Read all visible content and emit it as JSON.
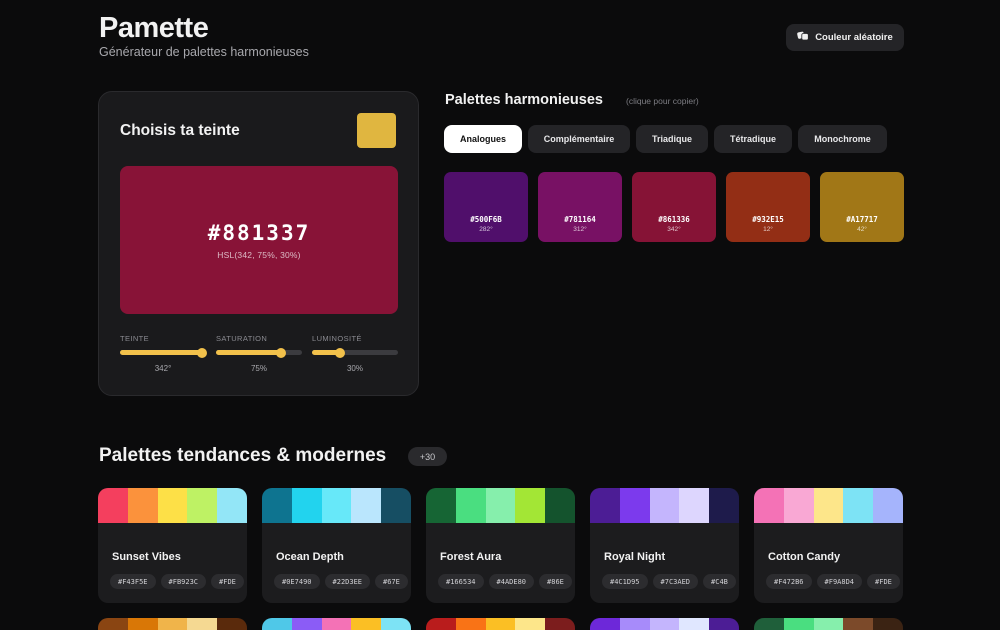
{
  "header": {
    "title": "Pamette",
    "subtitle": "Générateur de palettes harmonieuses",
    "random_button": "Couleur aléatoire",
    "random_icon": "dice-icon"
  },
  "picker": {
    "title": "Choisis ta teinte",
    "current_color": "#881337",
    "hex": "#881337",
    "hsl": "HSL(342, 75%, 30%)",
    "sliders": [
      {
        "label": "TEINTE",
        "value": "342°",
        "fraction": 0.95
      },
      {
        "label": "SATURATION",
        "value": "75%",
        "fraction": 0.75
      },
      {
        "label": "LUMINOSITÉ",
        "value": "30%",
        "fraction": 0.33
      }
    ],
    "accent": "#F2C14B",
    "swatch_color": "#E0B640"
  },
  "harmony": {
    "title": "Palettes harmonieuses",
    "hint": "(clique pour copier)",
    "tabs": [
      {
        "label": "Analogues",
        "active": true
      },
      {
        "label": "Complémentaire",
        "active": false
      },
      {
        "label": "Triadique",
        "active": false
      },
      {
        "label": "Tétradique",
        "active": false
      },
      {
        "label": "Monochrome",
        "active": false
      }
    ],
    "swatches": [
      {
        "hex": "#500F6B",
        "deg": "282°"
      },
      {
        "hex": "#781164",
        "deg": "312°"
      },
      {
        "hex": "#861336",
        "deg": "342°"
      },
      {
        "hex": "#932E15",
        "deg": "12°"
      },
      {
        "hex": "#A17717",
        "deg": "42°"
      }
    ]
  },
  "trends": {
    "title": "Palettes tendances & modernes",
    "count_badge": "+30",
    "palettes": [
      {
        "name": "Sunset Vibes",
        "colors": [
          "#F43F5E",
          "#FB923C",
          "#FDE047",
          "#BEF264",
          "#93E6F7"
        ],
        "chips": [
          "#F43F5E",
          "#FB923C",
          "#FDE"
        ]
      },
      {
        "name": "Ocean Depth",
        "colors": [
          "#0E7490",
          "#22D3EE",
          "#67E8F9",
          "#BAE6FD",
          "#164E63"
        ],
        "chips": [
          "#0E7490",
          "#22D3EE",
          "#67E"
        ]
      },
      {
        "name": "Forest Aura",
        "colors": [
          "#166534",
          "#4ADE80",
          "#86EFAC",
          "#A3E635",
          "#14532D"
        ],
        "chips": [
          "#166534",
          "#4ADE80",
          "#86E"
        ]
      },
      {
        "name": "Royal Night",
        "colors": [
          "#4C1D95",
          "#7C3AED",
          "#C4B5FD",
          "#DDD6FE",
          "#1E1B4B"
        ],
        "chips": [
          "#4C1D95",
          "#7C3AED",
          "#C4B"
        ]
      },
      {
        "name": "Cotton Candy",
        "colors": [
          "#F472B6",
          "#F9A8D4",
          "#FDE68A",
          "#7DE3F5",
          "#A5B4FC"
        ],
        "chips": [
          "#F472B6",
          "#F9A8D4",
          "#FDE"
        ]
      }
    ],
    "row2_colors": [
      [
        "#8A4512",
        "#D97706",
        "#F0B44A",
        "#F5D992",
        "#5A2A0C"
      ],
      [
        "#4FC8E8",
        "#8B5CF6",
        "#F472B6",
        "#FBBF24",
        "#7DE3F5"
      ],
      [
        "#B91C1C",
        "#F97316",
        "#FBBF24",
        "#FDE68A",
        "#7C1D1D"
      ],
      [
        "#6D28D9",
        "#A78BFA",
        "#C4B5FD",
        "#E0E7FF",
        "#4C1D95"
      ],
      [
        "#1F5F3A",
        "#4ADE80",
        "#86EFAC",
        "#7C4A2A",
        "#3B2313"
      ]
    ]
  }
}
